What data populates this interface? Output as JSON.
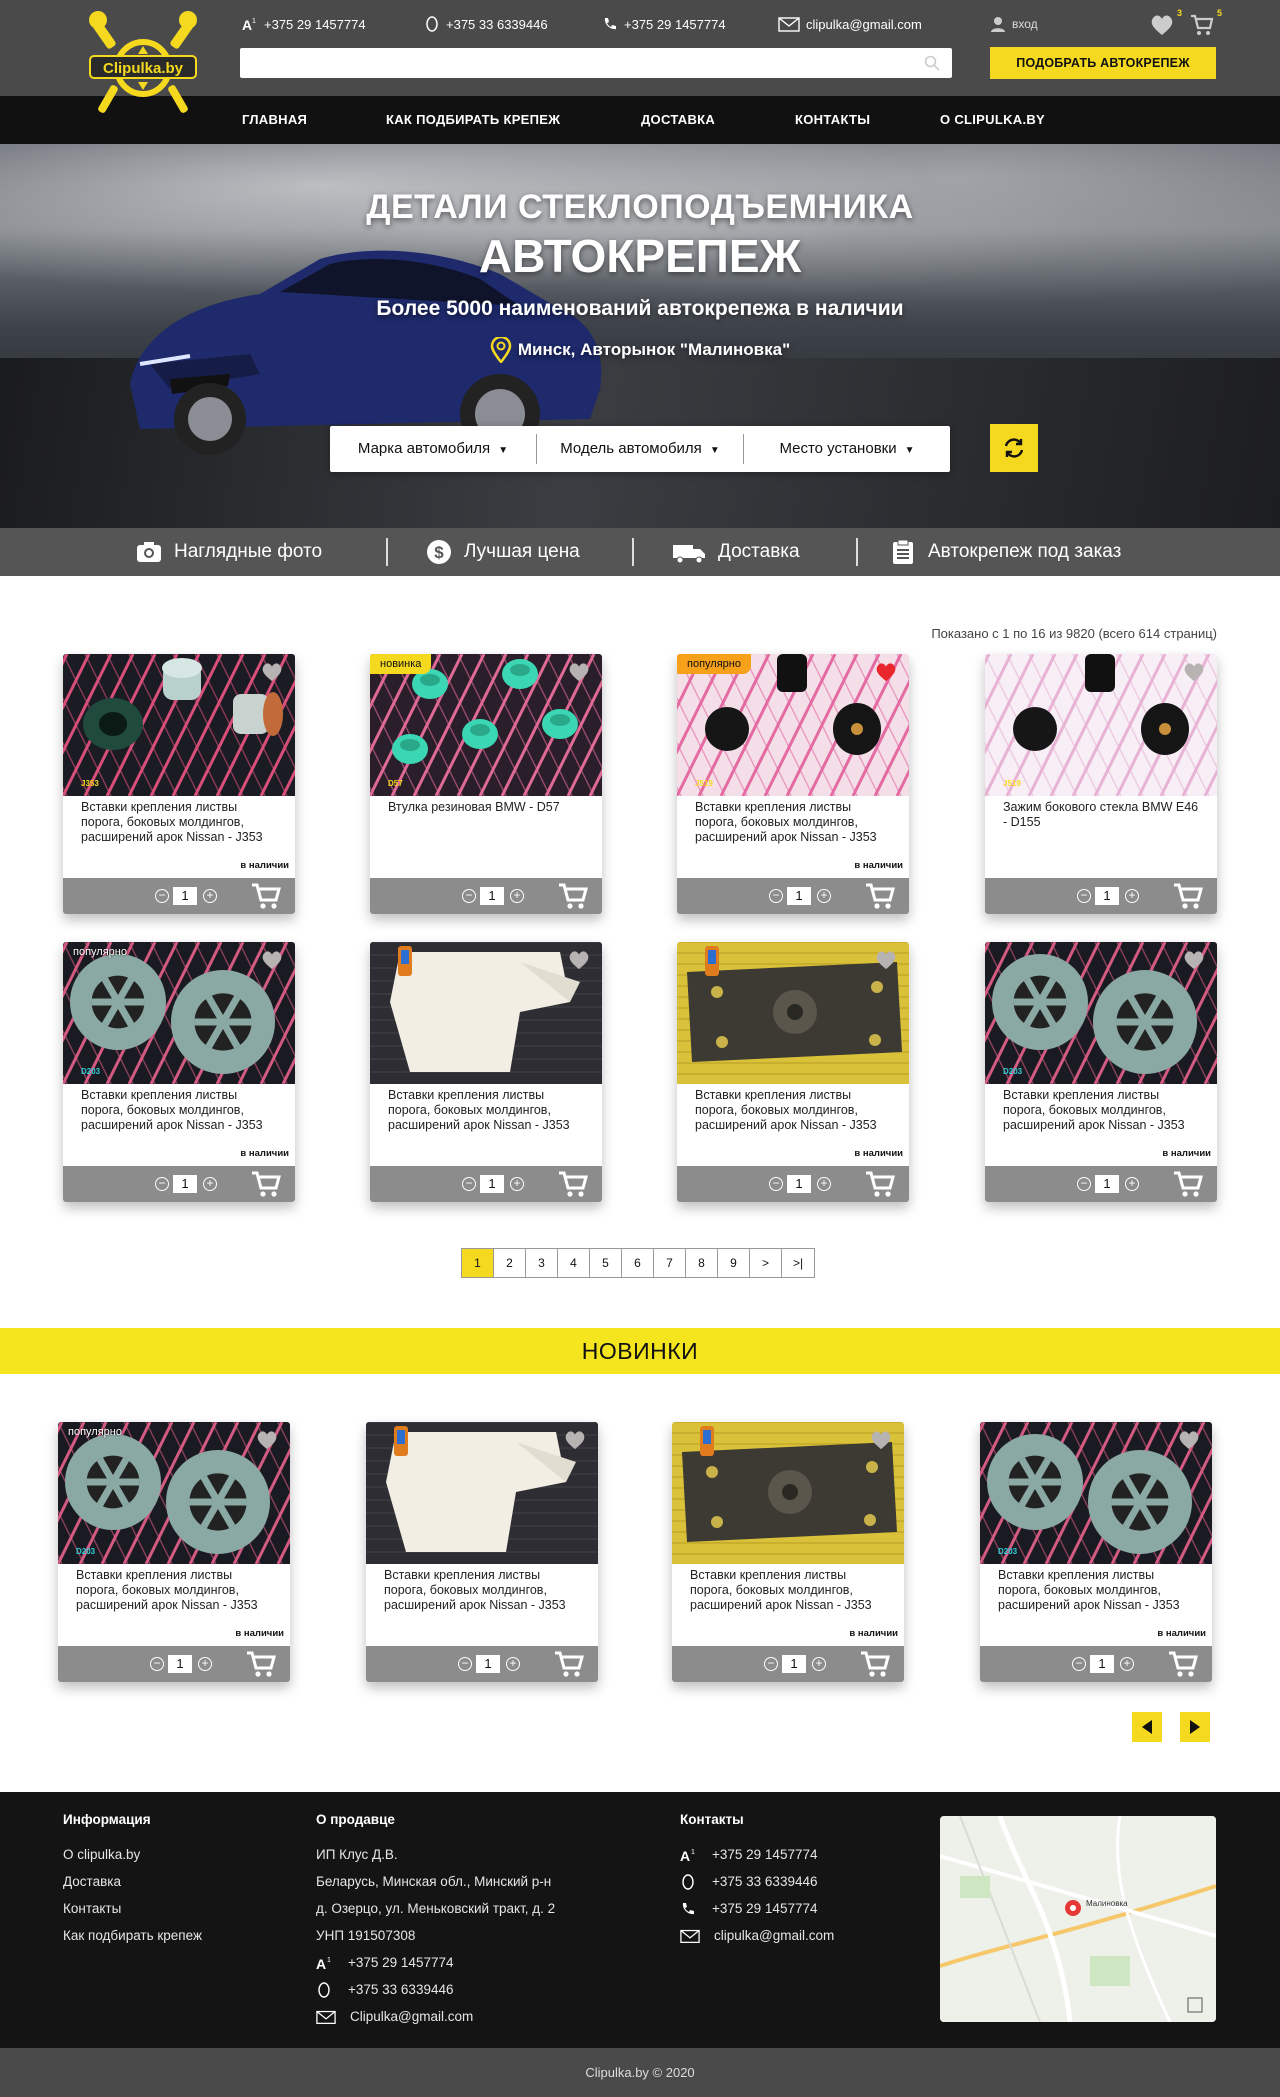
{
  "brand": {
    "name": "Clipulka.by",
    "yellow": "#f5d91f",
    "dark": "#141414"
  },
  "header": {
    "contacts": [
      {
        "icon": "a1-icon",
        "text": "+375 29 1457774"
      },
      {
        "icon": "mts-icon",
        "text": "+375 33 6339446"
      },
      {
        "icon": "phone-icon",
        "text": "+375 29 1457774"
      },
      {
        "icon": "mail-icon",
        "text": "clipulka@gmail.com"
      }
    ],
    "login_label": "вход",
    "favorites_count": "3",
    "cart_count": "5",
    "search_placeholder": "",
    "cta_label": "ПОДОБРАТЬ АВТОКРЕПЕЖ"
  },
  "nav": [
    "ГЛАВНАЯ",
    "КАК ПОДБИРАТЬ КРЕПЕЖ",
    "ДОСТАВКА",
    "КОНТАКТЫ",
    "О CLIPULKA.BY"
  ],
  "hero": {
    "line1": "ДЕТАЛИ СТЕКЛОПОДЪЕМНИКА",
    "line2": "АВТОКРЕПЕЖ",
    "line3": "Более 5000 наименований автокрепежа в наличии",
    "location": "Минск, Авторынок \"Малиновка\"",
    "selectors": [
      "Марка автомобиля",
      "Модель автомобиля",
      "Место установки"
    ]
  },
  "features": [
    "Наглядные фото",
    "Лучшая цена",
    "Доставка",
    "Автокрепеж под заказ"
  ],
  "catalog": {
    "results_info": "Показано с 1 по 16 из 9820 (всего 614 страниц)",
    "stock_label": "в наличии",
    "products": [
      {
        "title": "Вставки крепления листвы порога, боковых молдингов, расширений арок Nissan - J353",
        "badge": "",
        "img": "grommet-dark",
        "code": "J353",
        "qty": "1",
        "in_stock": true,
        "fav": false
      },
      {
        "title": "Втулка резиновая BMW - D57",
        "badge": "новинка",
        "img": "grommet-teal",
        "code": "D57",
        "qty": "1",
        "in_stock": false,
        "fav": false
      },
      {
        "title": "Вставки крепления листвы порога, боковых молдингов, расширений арок Nissan - J353",
        "badge": "популярно",
        "img": "nuts-pink",
        "code": "J519",
        "qty": "1",
        "in_stock": true,
        "fav": true
      },
      {
        "title": "Зажим бокового стекла BMW E46 - D155",
        "badge": "",
        "img": "nuts-light",
        "code": "J519",
        "qty": "1",
        "in_stock": false,
        "fav": false
      },
      {
        "title": "Вставки крепления листвы порога, боковых молдингов, расширений арок Nissan - J353",
        "badge": "популярно",
        "img": "clips-metal",
        "code": "D203",
        "qty": "1",
        "in_stock": true,
        "fav": false
      },
      {
        "title": "Вставки крепления листвы порога, боковых молдингов, расширений арок Nissan - J353",
        "badge": "",
        "img": "bracket-white",
        "code": "",
        "qty": "1",
        "in_stock": false,
        "fav": false
      },
      {
        "title": "Вставки крепления листвы порога, боковых молдингов, расширений арок Nissan - J353",
        "badge": "",
        "img": "plate-dark",
        "code": "",
        "qty": "1",
        "in_stock": true,
        "fav": false
      },
      {
        "title": "Вставки крепления листвы порога, боковых молдингов, расширений арок Nissan - J353",
        "badge": "",
        "img": "clips-metal",
        "code": "D203",
        "qty": "1",
        "in_stock": true,
        "fav": false
      }
    ],
    "pages": [
      "1",
      "2",
      "3",
      "4",
      "5",
      "6",
      "7",
      "8",
      "9",
      ">",
      ">|"
    ],
    "current_page": "1"
  },
  "new_section": {
    "title": "НОВИНКИ",
    "products": [
      {
        "title": "Вставки крепления листвы порога, боковых молдингов, расширений арок Nissan - J353",
        "badge": "популярно",
        "img": "clips-metal",
        "code": "D203",
        "qty": "1",
        "in_stock": true,
        "fav": false
      },
      {
        "title": "Вставки крепления листвы порога, боковых молдингов, расширений арок Nissan - J353",
        "badge": "",
        "img": "bracket-white",
        "code": "",
        "qty": "1",
        "in_stock": false,
        "fav": false
      },
      {
        "title": "Вставки крепления листвы порога, боковых молдингов, расширений арок Nissan - J353",
        "badge": "",
        "img": "plate-dark",
        "code": "",
        "qty": "1",
        "in_stock": true,
        "fav": false
      },
      {
        "title": "Вставки крепления листвы порога, боковых молдингов, расширений арок Nissan - J353",
        "badge": "",
        "img": "clips-metal",
        "code": "D203",
        "qty": "1",
        "in_stock": true,
        "fav": false
      }
    ]
  },
  "footer": {
    "info": {
      "title": "Информация",
      "links": [
        "О clipulka.by",
        "Доставка",
        "Контакты",
        "Как подбирать крепеж"
      ]
    },
    "seller": {
      "title": "О продавце",
      "lines": [
        "ИП Клус Д.В.",
        "Беларусь, Минская обл., Минский р-н",
        "д. Озерцо, ул. Меньковский тракт, д. 2",
        "УНП 191507308"
      ],
      "contacts": [
        {
          "icon": "a1-icon",
          "text": "+375 29 1457774"
        },
        {
          "icon": "mts-icon",
          "text": "+375 33 6339446"
        },
        {
          "icon": "mail-icon",
          "text": "Clipulka@gmail.com"
        }
      ]
    },
    "contacts": {
      "title": "Контакты",
      "items": [
        {
          "icon": "a1-icon",
          "text": "+375 29 1457774"
        },
        {
          "icon": "mts-icon",
          "text": "+375 33 6339446"
        },
        {
          "icon": "phone-icon",
          "text": "+375 29 1457774"
        },
        {
          "icon": "mail-icon",
          "text": "clipulka@gmail.com"
        }
      ]
    },
    "map_label": "Малиновка",
    "copyright": "Clipulka.by © 2020"
  }
}
